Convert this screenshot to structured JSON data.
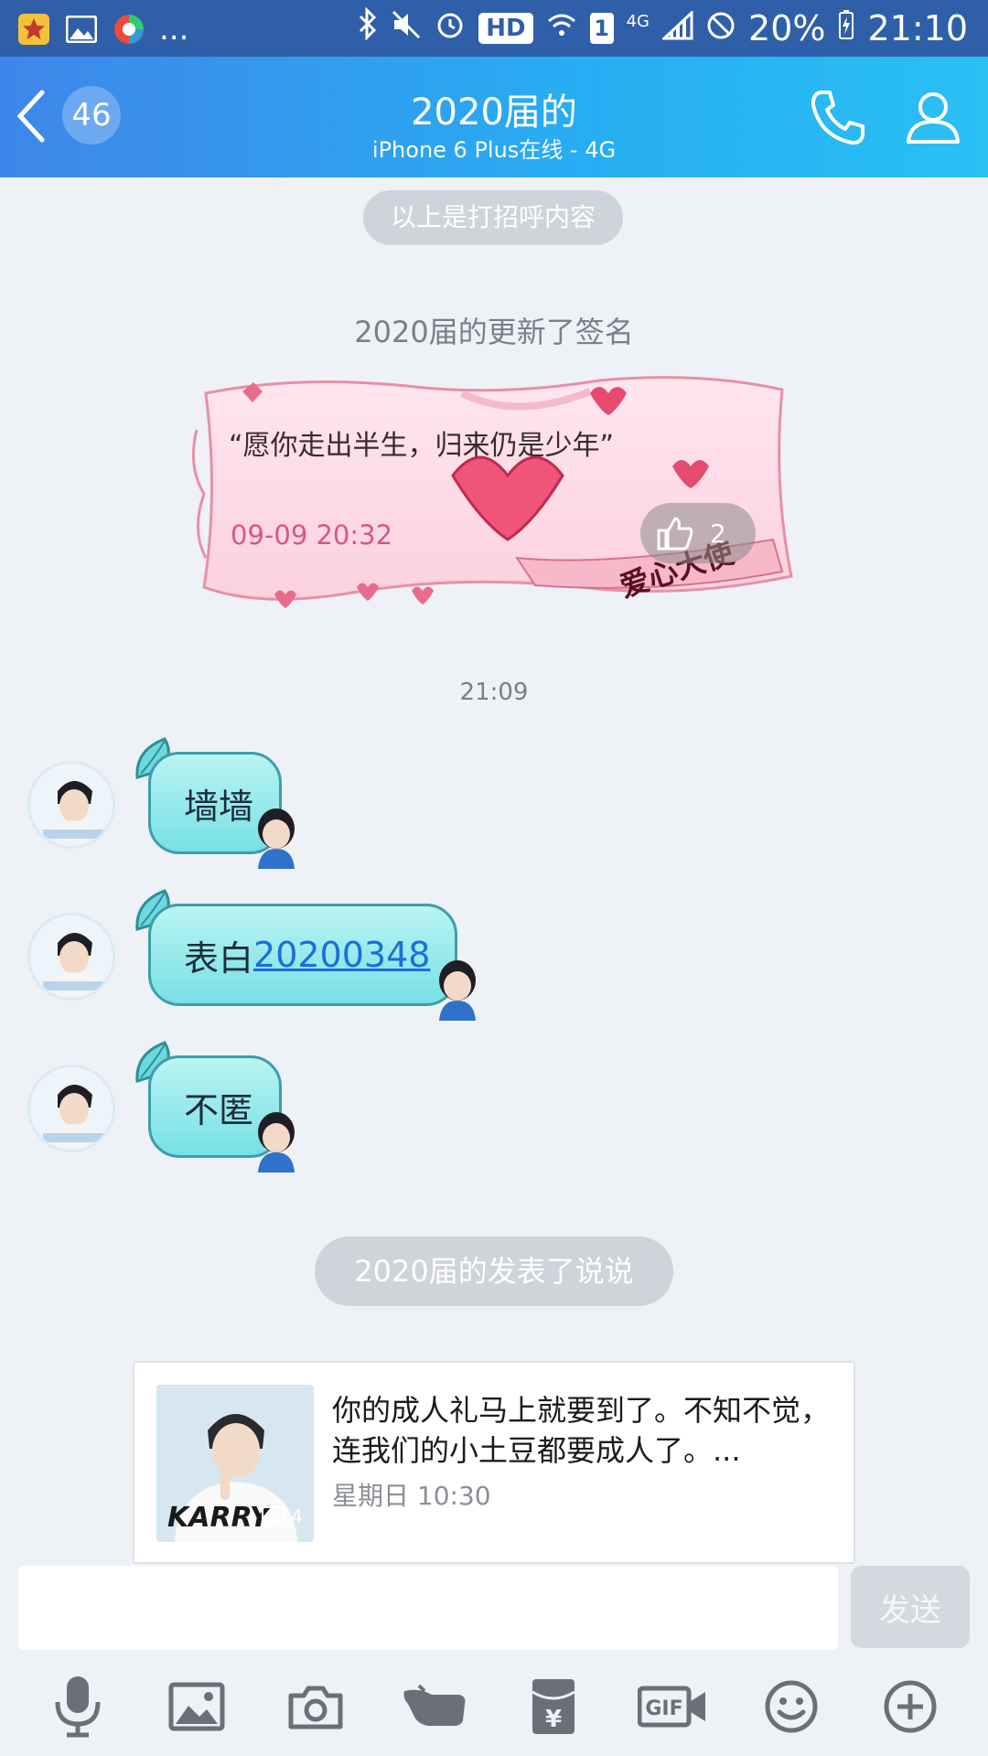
{
  "status_bar": {
    "left_icons": [
      "star-app-icon",
      "gallery-icon",
      "browser-app-icon"
    ],
    "more": "...",
    "hd": "HD",
    "sim": "1",
    "network": "4G",
    "battery": "20%",
    "time": "21:10"
  },
  "header": {
    "back_count": "46",
    "title": "2020届的",
    "subtitle": "iPhone 6 Plus在线 - 4G"
  },
  "chat": {
    "greeting_notice": "以上是打招呼内容",
    "signature_notice": "2020届的更新了签名",
    "signature": {
      "text": "“愿你走出半生，归来仍是少年”",
      "time": "09-09 20:32",
      "likes": "2",
      "sticker_text": "爱心大使"
    },
    "timestamp": "21:09",
    "messages": [
      {
        "text": "墙墙"
      },
      {
        "prefix": "表白",
        "link": "20200348"
      },
      {
        "text": "不匿"
      }
    ],
    "post_notice": "2020届的发表了说说",
    "post": {
      "text": "你的成人礼马上就要到了。不知不觉，连我们的小土豆都要成人了。...",
      "date": "星期日 10:30",
      "image_count": "4",
      "thumb_text": "KARRY"
    }
  },
  "input": {
    "placeholder": "",
    "send_label": "发送"
  },
  "toolbar": {
    "items": [
      "microphone-icon",
      "image-icon",
      "camera-icon",
      "poke-icon",
      "red-packet-icon",
      "gif-icon",
      "emoji-icon",
      "plus-icon"
    ],
    "gif_label": "GIF",
    "yen": "¥"
  },
  "colors": {
    "header_start": "#3f86ea",
    "header_end": "#2ac0f4",
    "bubble": "#77e0e6",
    "link": "#1b6fd6"
  }
}
